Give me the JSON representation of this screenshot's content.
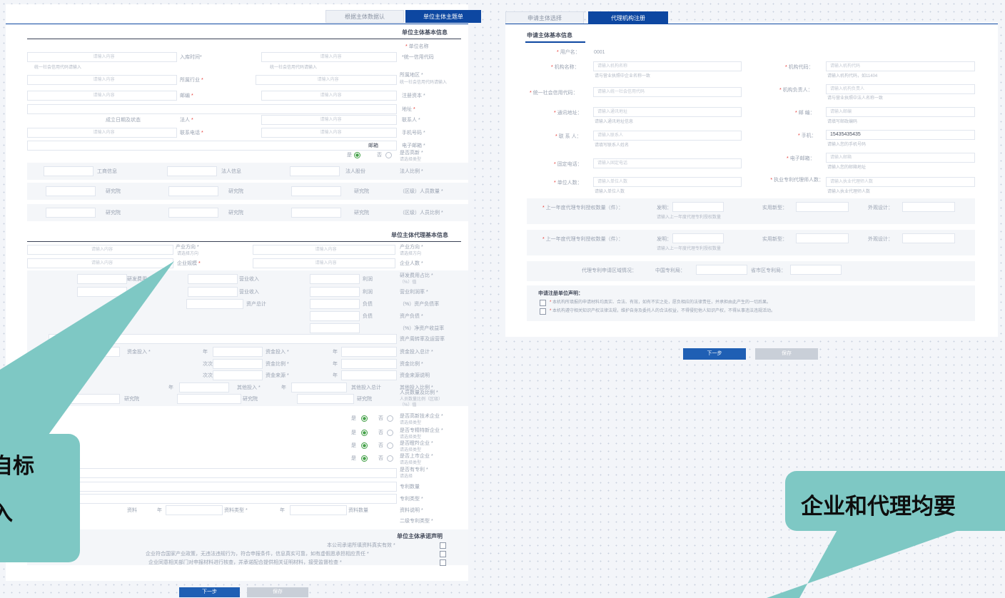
{
  "left_form": {
    "tabs": [
      {
        "label": "根据主体数据认"
      },
      {
        "label": "单位主体主题单"
      }
    ],
    "section1_title": "单位主体基本信息",
    "section2_title": "单位主体代理基本信息",
    "section3_title": "单位主体承诺声明",
    "placeholder": "请输入内容",
    "labels": [
      "* 单位名称",
      "* 统一社会信用代码",
      "* 单位地址",
      "* 联系人",
      "* 手机号码",
      "* 邮箱",
      "* 法定代表人",
      "* 注册资本",
      "* 成立日期",
      "* 所属行业"
    ],
    "radio_yes": "是",
    "radio_no": "否",
    "btn_next": "下一步",
    "btn_save": "保存"
  },
  "right_form": {
    "tabs": [
      {
        "label": "申请主体选择"
      },
      {
        "label": "代理机构注册"
      }
    ],
    "section_title": "申请主体基本信息",
    "user_label": "用户名：",
    "user_value": "0001",
    "fields_left": [
      {
        "label": "机构名称：",
        "placeholder": "请输入机构名称",
        "hint": "请与营业执照中企业名称一致"
      },
      {
        "label": "统一社会信用代码：",
        "placeholder": "请输入统一社会信用代码",
        "hint": ""
      },
      {
        "label": "通讯地址：",
        "placeholder": "请输入通讯地址",
        "hint": "请输入通讯地址信息"
      },
      {
        "label": "联 系 人：",
        "placeholder": "请输入联系人",
        "hint": "请填写联系人姓名"
      },
      {
        "label": "固定电话：",
        "placeholder": "请输入固定电话",
        "hint": ""
      },
      {
        "label": "单位人数：",
        "placeholder": "请输入单位人数",
        "hint": "请输入单位人数"
      }
    ],
    "fields_right": [
      {
        "label": "机构代码：",
        "placeholder": "请输入机构代码",
        "hint": "请输入机构代码，如11404"
      },
      {
        "label": "机构负责人：",
        "placeholder": "请输入机构负责人",
        "hint": "请与营业执照中法人名称一致"
      },
      {
        "label": "邮  编：",
        "placeholder": "请输入邮编",
        "hint": "请填写邮政编码"
      },
      {
        "label": "手机：",
        "placeholder": "15435435435",
        "hint": "请输入您的手机号码"
      },
      {
        "label": "电子邮箱：",
        "placeholder": "请输入邮箱",
        "hint": "请输入您的邮箱地址"
      },
      {
        "label": "执业专利代理师人数：",
        "placeholder": "请输入执业代理师人数",
        "hint": "请输入执业代理师人数"
      }
    ],
    "band1": {
      "label": "上一年度代理专利授权数量（件）：",
      "f1": "发明：",
      "f2": "实用新型：",
      "f3": "外观设计：",
      "hint": "请输入上一年度代理专利授权数量"
    },
    "band2": {
      "label": "上一年度代理专利授权数量（件）：",
      "f1": "发明：",
      "f2": "实用新型：",
      "f3": "外观设计：",
      "hint": "请输入上一年度代理专利授权数量"
    },
    "band3": {
      "label": "代理专利申请区域情况：",
      "f1": "中国专利局：",
      "f2": "省市区专利局："
    },
    "declaration_title": "申请注册单位声明：",
    "declarations": [
      "本机构所填报的申请材料均真实、合法、有效，如有不实之处，愿负相应的法律责任，并承担由此产生的一切后果。",
      "本机构遵守相关知识产权法律法规，维护自身及委托人的合法权益，不得侵犯他人知识产权，不得从事违法违规活动。"
    ],
    "btn_next": "下一步",
    "btn_save": "保存"
  },
  "callouts": {
    "left": "自标",
    "left_sub": "入",
    "right": "企业和代理均要"
  },
  "colors": {
    "primary": "#0d47a1",
    "callout": "#7ec8c4",
    "required": "#e53935"
  }
}
